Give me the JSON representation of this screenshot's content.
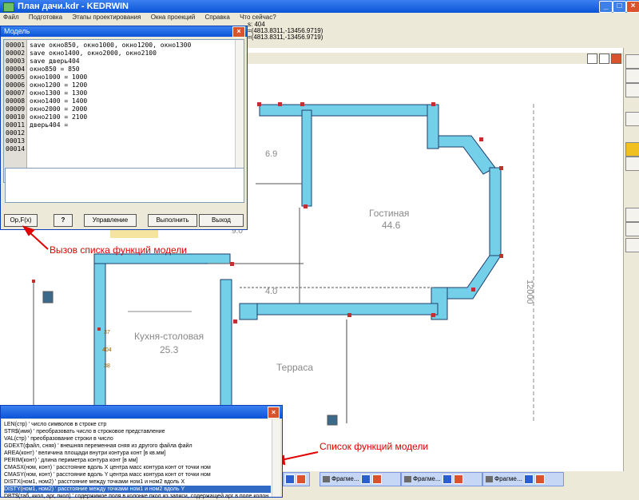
{
  "app": {
    "title": "План дачи.kdr - KEDRWIN",
    "accent": "#0a54d8",
    "close_color": "#d9532c"
  },
  "menu": {
    "items": [
      "Файл",
      "Подготовка",
      "Этапы проектирования",
      "Окна проекций",
      "Справка",
      "Что сейчас?"
    ]
  },
  "status": {
    "line1": "s: 404",
    "line2": "=(4813.8311,-13456.9719)",
    "line3": "=(4813.8311,-13456.9719)"
  },
  "model_window": {
    "title": "Модель",
    "line_numbers": [
      "00001",
      "00002",
      "00003",
      "00004",
      "00005",
      "00006",
      "00007",
      "00008",
      "00009",
      "00010",
      "00011",
      "00012",
      "00013",
      "00014"
    ],
    "code_lines": [
      "save окно850, окно1000, окно1200, окно1300",
      "save окно1400, окно2000, окно2100",
      "save дверь404",
      "окно850 = 850",
      "окно1000 = 1000",
      "окно1200 = 1200",
      "окно1300 = 1300",
      "окно1400 = 1400",
      "окно2000 = 2000",
      "окно2100 = 2100",
      "дверь404 =",
      "",
      "",
      ""
    ],
    "buttons": {
      "functions": "Op,F(x)",
      "help": "?",
      "control": "Управление",
      "run": "Выполнить",
      "exit": "Выход"
    }
  },
  "annotations": {
    "call_functions": "Вызов списка функций модели",
    "function_list": "Список функций модели",
    "color": "#e00000"
  },
  "plan": {
    "room1": "Гостиная",
    "room1_area": "44.6",
    "room2": "Кухня-столовая",
    "room2_area": "25.3",
    "terrace": "Терраса",
    "small_area": "6.9",
    "hall_area": "4.0",
    "dim_right": "12000",
    "small_label": "9.0",
    "mark1": "37",
    "mark2": "404",
    "mark3": "38"
  },
  "function_window": {
    "items": [
      "LEN(стр)  ' число символов в строке стр",
      "STR$(имя)  ' преобразовать число в строковое представление",
      "VAL(стр)  ' преобразование строки в число",
      "GDEXT(файл, сняя)  ' внешняя переменная сняя из другого файла файл",
      "AREA(конт)  ' величина площади внутри контура конт [в кв.мм]",
      "PERIM(конт)  ' длина периметра контура конт [в мм]",
      "CMASX(ном, конт)  ' расстояние вдоль X центра масс контура конт от точки ном",
      "CMASY(ном, конт)  ' расстояние вдоль Y центра масс контура конт от точки ном",
      "DISTX(ном1, ном2)  ' расстояние между точками ном1 и ном2 вдоль X",
      "DISTY(ном1, ном2)  ' расстояние между точками ном1 и ном2 вдоль Y",
      "DBT$(таб, ккол, арг, пкол)  ' содержимое поля в колонке пкол из записи, содержащей арг в поле колон"
    ],
    "selected_index": 9
  },
  "fragment_tabs": [
    {
      "label": "Фрагме..."
    },
    {
      "label": "Фрагме..."
    },
    {
      "label": "Фрагме..."
    }
  ]
}
